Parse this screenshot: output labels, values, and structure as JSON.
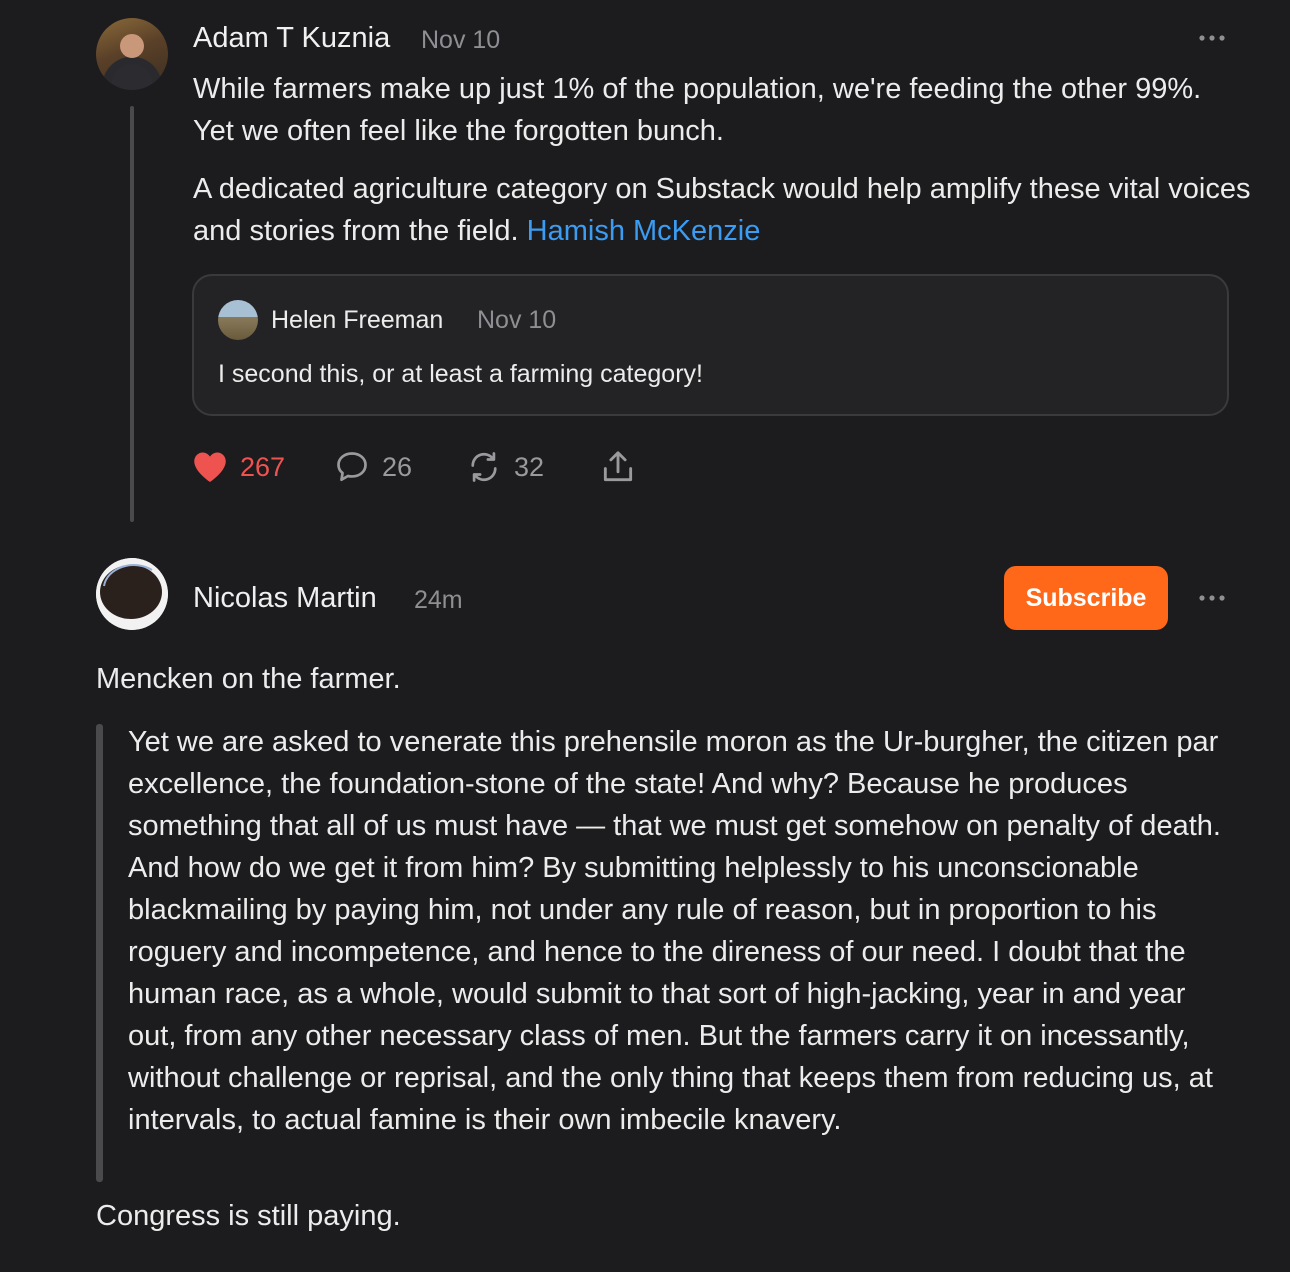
{
  "note1": {
    "author": "Adam T Kuznia",
    "date": "Nov 10",
    "text_before": "While farmers make up just 1% of the population, we're feeding the other 99%. Yet we often feel like the forgotten bunch.",
    "text_second": "A dedicated agriculture category on Substack would help amplify these vital voices and stories from the field.",
    "mention": "Hamish McKenzie",
    "quoted": {
      "author": "Helen Freeman",
      "date": "Nov 10",
      "text": "I second this, or at least a farming category!"
    },
    "actions": {
      "likes": "267",
      "comments": "26",
      "restacks": "32"
    }
  },
  "note2": {
    "author": "Nicolas Martin",
    "date": "24m",
    "subscribe_label": "Subscribe",
    "intro": "Mencken on the farmer.",
    "blockquote": "Yet we are asked to venerate this prehensile moron as the Ur-burgher, the citizen par excellence, the foundation-stone of the state! And why? Because he produces something that all of us must have — that we must get somehow on penalty of death. And how do we get it from him? By submitting helplessly to his unconscionable blackmailing by paying him, not under any rule of reason, but in proportion to his roguery and incompetence, and hence to the direness of our need. I doubt that the human race, as a whole, would submit to that sort of high-jacking, year in and year out, from any other necessary class of men. But the farmers carry it on incessantly, without challenge or reprisal, and the only thing that keeps them from reducing us, at intervals, to actual famine is their own imbecile knavery.",
    "outro": "Congress is still paying."
  },
  "colors": {
    "background": "#1c1c1e",
    "like_red": "#ef5350",
    "mention_blue": "#3b9cf2",
    "subscribe_orange": "#ff6719",
    "muted": "#8e8e93"
  }
}
